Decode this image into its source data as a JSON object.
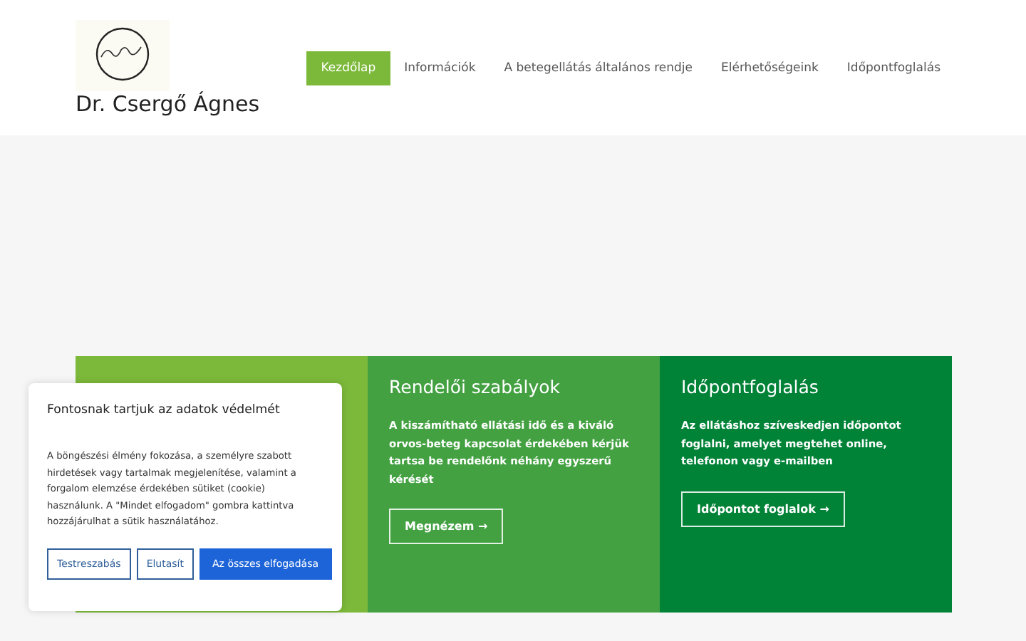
{
  "site": {
    "title": "Dr. Csergő Ágnes"
  },
  "nav": [
    {
      "label": "Kezdőlap",
      "selected": true
    },
    {
      "label": "Információk",
      "selected": false
    },
    {
      "label": "A betegellátás általános rendje",
      "selected": false
    },
    {
      "label": "Elérhetőségeink",
      "selected": false
    },
    {
      "label": "Időpontfoglalás",
      "selected": false
    }
  ],
  "cards": [
    {
      "color": "#7cb93a"
    },
    {
      "color": "#43a142",
      "title": "Rendelői szabályok",
      "text": "A kiszámítható ellátási idő és a kiváló orvos-beteg kapcsolat érdekében kérjük tartsa be rendelőnk néhány egyszerű kérését",
      "button": "Megnézem →"
    },
    {
      "color": "#008237",
      "title": "Időpontfoglalás",
      "text": "Az ellátáshoz szíveskedjen időpontot foglalni, amelyet megtehet online, telefonon vagy e-mailben",
      "button": "Időpontot foglalok →"
    }
  ],
  "cookie": {
    "title": "Fontosnak tartjuk az adatok védelmét",
    "text": "A böngészési élmény fokozása, a személyre szabott hirdetések vagy tartalmak megjelenítése, valamint a forgalom elemzése érdekében sütiket (cookie) használunk. A \"Mindet elfogadom\" gombra kattintva hozzájárulhat a sütik használatához.",
    "buttons": [
      {
        "label": "Testreszabás",
        "kind": "outline"
      },
      {
        "label": "Elutasít",
        "kind": "outline"
      },
      {
        "label": "Az összes elfogadása",
        "kind": "primary"
      }
    ]
  }
}
